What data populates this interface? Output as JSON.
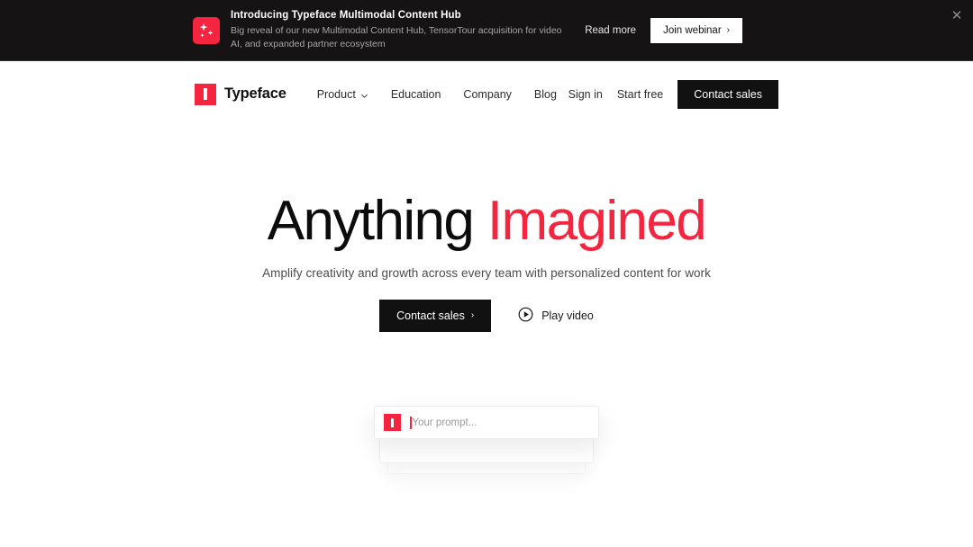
{
  "banner": {
    "icon_name": "sparkle-icon",
    "title": "Introducing Typeface Multimodal Content Hub",
    "subtitle": "Big reveal of our new Multimodal Content Hub, TensorTour acquisition for video AI, and expanded partner ecosystem",
    "read_more_label": "Read more",
    "join_webinar_label": "Join webinar",
    "join_webinar_chevron": "›",
    "close_label": "✕",
    "background_color": "#151314"
  },
  "header": {
    "brand_name": "Typeface",
    "nav": [
      {
        "label": "Product",
        "has_dropdown": true
      },
      {
        "label": "Education",
        "has_dropdown": false
      },
      {
        "label": "Company",
        "has_dropdown": false
      },
      {
        "label": "Blog",
        "has_dropdown": false
      }
    ],
    "sign_in_label": "Sign in",
    "start_free_label": "Start free",
    "contact_sales_label": "Contact sales"
  },
  "hero": {
    "title_primary": "Anything",
    "title_accent": "Imagined",
    "subtitle": "Amplify creativity and growth across every team with personalized content for work",
    "cta_label": "Contact sales",
    "cta_chevron": "›",
    "play_video_label": "Play video"
  },
  "prompt": {
    "placeholder": "Your prompt...",
    "value": ""
  },
  "colors": {
    "accent_red": "#F5243F",
    "dark": "#111111",
    "banner_bg": "#151314",
    "muted_text": "#9b9799"
  }
}
